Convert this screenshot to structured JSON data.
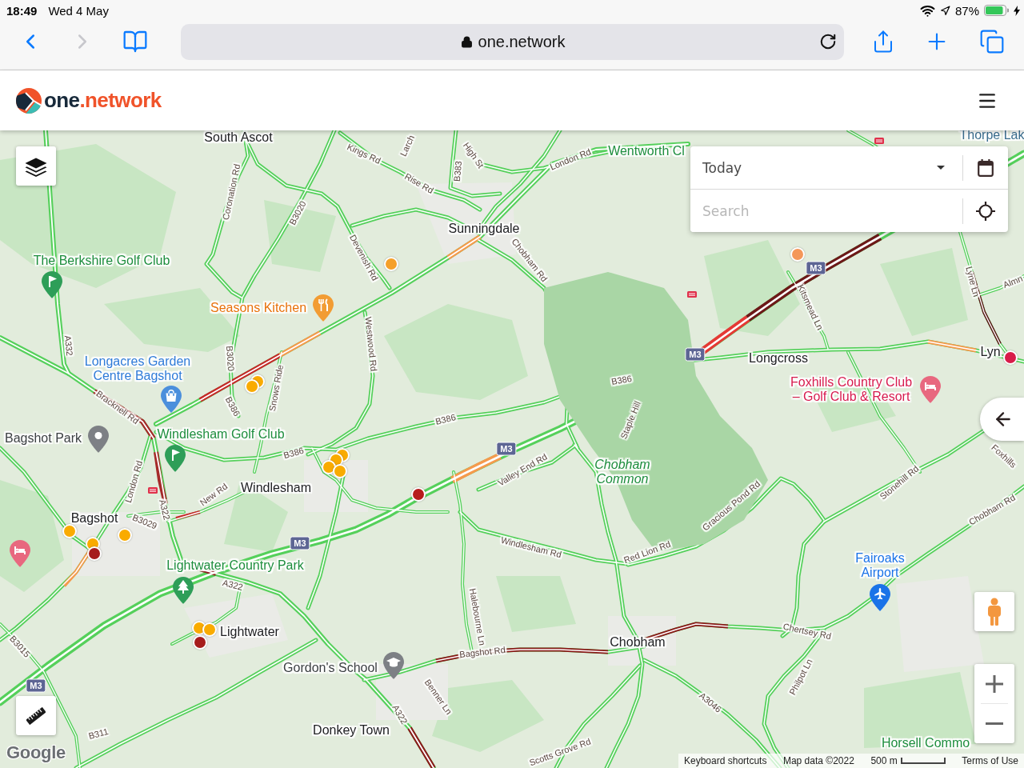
{
  "status_bar": {
    "time": "18:49",
    "date": "Wed 4 May",
    "battery": "87%"
  },
  "browser": {
    "nav": [
      {
        "kind": "back",
        "disabled": false
      },
      {
        "kind": "forward",
        "disabled": true
      }
    ],
    "url": "one.network"
  },
  "header": {
    "logo": {
      "first": "one",
      "second": ".network"
    }
  },
  "map": {
    "labels": [
      {
        "text": "South Ascot",
        "kind": "town"
      },
      {
        "text": "Kings Rd",
        "kind": "road"
      },
      {
        "text": "Larch",
        "kind": "road"
      },
      {
        "text": "High St",
        "kind": "road"
      },
      {
        "text": "B383",
        "kind": "road"
      },
      {
        "text": "Rise Rd",
        "kind": "road"
      },
      {
        "text": "London Rd",
        "kind": "road"
      },
      {
        "text": "Wentworth Cl",
        "kind": "green"
      },
      {
        "text": "Thorpe Lak",
        "kind": "water"
      },
      {
        "text": "Coronation Rd",
        "kind": "road"
      },
      {
        "text": "B3020",
        "kind": "road"
      },
      {
        "text": "Sunningdale",
        "kind": "town"
      },
      {
        "text": "Devenish Rd",
        "kind": "road"
      },
      {
        "text": "Chobham Rd",
        "kind": "road"
      },
      {
        "text": "The Berkshire Golf Club",
        "kind": "green"
      },
      {
        "text": "Seasons Kitchen",
        "kind": "food"
      },
      {
        "text": "Westwood Rd",
        "kind": "road"
      },
      {
        "text": "A332",
        "kind": "road"
      },
      {
        "text": "Longacres Garden Centre Bagshot",
        "kind": "shop"
      },
      {
        "text": "B3020",
        "kind": "road"
      },
      {
        "text": "Bracknell Rd",
        "kind": "road"
      },
      {
        "text": "B386",
        "kind": "road"
      },
      {
        "text": "Snows Ride",
        "kind": "road"
      },
      {
        "text": "B386",
        "kind": "road"
      },
      {
        "text": "B386",
        "kind": "road"
      },
      {
        "text": "Windlesham Golf Club",
        "kind": "green"
      },
      {
        "text": "Bagshot Park",
        "kind": "place"
      },
      {
        "text": "B386",
        "kind": "road"
      },
      {
        "text": "London Rd",
        "kind": "road"
      },
      {
        "text": "A322",
        "kind": "road"
      },
      {
        "text": "New Rd",
        "kind": "road"
      },
      {
        "text": "Windlesham",
        "kind": "town"
      },
      {
        "text": "B3029",
        "kind": "road"
      },
      {
        "text": "Bagshot",
        "kind": "town"
      },
      {
        "text": "Lightwater Country Park",
        "kind": "green"
      },
      {
        "text": "A322",
        "kind": "road"
      },
      {
        "text": "Lightwater",
        "kind": "town"
      },
      {
        "text": "B3015",
        "kind": "road"
      },
      {
        "text": "Gordon's School",
        "kind": "place"
      },
      {
        "text": "Benner Ln",
        "kind": "road"
      },
      {
        "text": "A322",
        "kind": "road"
      },
      {
        "text": "B311",
        "kind": "road"
      },
      {
        "text": "Donkey Town",
        "kind": "town"
      },
      {
        "text": "Scotts Grove Rd",
        "kind": "road"
      },
      {
        "text": "Bagshot Rd",
        "kind": "road"
      },
      {
        "text": "Halebourne Ln",
        "kind": "road"
      },
      {
        "text": "Windlesham Rd",
        "kind": "road"
      },
      {
        "text": "Valley End Rd",
        "kind": "road"
      },
      {
        "text": "Chobham Common",
        "kind": "nature"
      },
      {
        "text": "Staple Hill",
        "kind": "road"
      },
      {
        "text": "Longcross",
        "kind": "town"
      },
      {
        "text": "Kitsmead Ln",
        "kind": "road"
      },
      {
        "text": "Lyne Ln",
        "kind": "road"
      },
      {
        "text": "Almn",
        "kind": "road"
      },
      {
        "text": "Lyn",
        "kind": "town"
      },
      {
        "text": "Foxhills Country Club – Golf Club & Resort",
        "kind": "hotel"
      },
      {
        "text": "Foxhills",
        "kind": "road"
      },
      {
        "text": "Stonehill Rd",
        "kind": "road"
      },
      {
        "text": "Gracious Pond Rd",
        "kind": "road"
      },
      {
        "text": "Red Lion Rd",
        "kind": "road"
      },
      {
        "text": "Chobham Rd",
        "kind": "road"
      },
      {
        "text": "Fairoaks Airport",
        "kind": "airport"
      },
      {
        "text": "Chertsey Rd",
        "kind": "road"
      },
      {
        "text": "Philpot Ln",
        "kind": "road"
      },
      {
        "text": "Chobham",
        "kind": "town"
      },
      {
        "text": "A3046",
        "kind": "road"
      },
      {
        "text": "Horsell Commo",
        "kind": "green"
      }
    ],
    "shields": [
      "M3",
      "M3",
      "M3",
      "M3",
      "M3"
    ],
    "pins": [
      {
        "kind": "golf"
      },
      {
        "kind": "food"
      },
      {
        "kind": "shop"
      },
      {
        "kind": "place"
      },
      {
        "kind": "golf"
      },
      {
        "kind": "hotel"
      },
      {
        "kind": "hotel"
      },
      {
        "kind": "park"
      },
      {
        "kind": "school"
      },
      {
        "kind": "airport"
      }
    ],
    "incidents": [
      {
        "color": "#f5a02a"
      },
      {
        "color": "#f4975a"
      },
      {
        "color": "#f9ab00"
      },
      {
        "color": "#f9ab00"
      },
      {
        "color": "#f9ab00"
      },
      {
        "color": "#f9ab00"
      },
      {
        "color": "#f9ab00"
      },
      {
        "color": "#f9ab00"
      },
      {
        "color": "#f9ab00"
      },
      {
        "color": "#f9ab00"
      },
      {
        "color": "#f9ab00"
      },
      {
        "color": "#a61c1c"
      },
      {
        "color": "#f9ab00"
      },
      {
        "color": "#f9ab00"
      },
      {
        "color": "#a61c1c"
      },
      {
        "color": "#b71c1c"
      },
      {
        "color": "#d81b4a"
      }
    ],
    "attribution_logo": "Google"
  },
  "search_panel": {
    "date_select": {
      "value": "Today"
    },
    "search": {
      "placeholder": "Search"
    }
  },
  "footer": {
    "items": [
      {
        "kind": "link",
        "text": "Keyboard shortcuts"
      },
      {
        "kind": "text",
        "text": "Map data ©2022"
      },
      {
        "kind": "scale",
        "text": "500 m"
      },
      {
        "kind": "link",
        "text": "Terms of Use"
      }
    ]
  }
}
